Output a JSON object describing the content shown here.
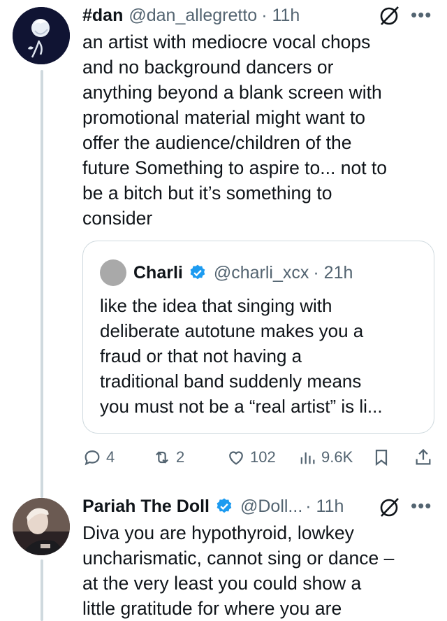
{
  "tweet": {
    "display_name": "#dan",
    "handle": "@dan_allegretto",
    "time": "· 11h",
    "text": "an artist with mediocre vocal chops\nand no background dancers or\nanything beyond a blank screen with\npromotional material might want to\noffer the audience/children of the\nfuture Something to aspire to... not to\nbe a bitch but it’s something to\nconsider",
    "more_icon": "•••"
  },
  "quoted": {
    "display_name": "Charli",
    "handle": "@charli_xcx",
    "time": "· 21h",
    "text": "like the idea that singing with\ndeliberate autotune makes you a\nfraud or that not having a\ntraditional band suddenly means\nyou must not be a “real artist” is li..."
  },
  "actions": {
    "replies": "4",
    "reposts": "2",
    "likes": "102",
    "views": "9.6K"
  },
  "reply": {
    "display_name": "Pariah The Doll",
    "handle": "@Doll...",
    "time": "· 11h",
    "text": "Diva you are hypothyroid, lowkey\nuncharismatic, cannot sing or dance –\nat the very least  you could show a\nlittle gratitude for where you are",
    "more_icon": "•••"
  },
  "colors": {
    "verified": "#1d9bf0",
    "secondary_text": "#536471",
    "border": "#cfd9de"
  }
}
